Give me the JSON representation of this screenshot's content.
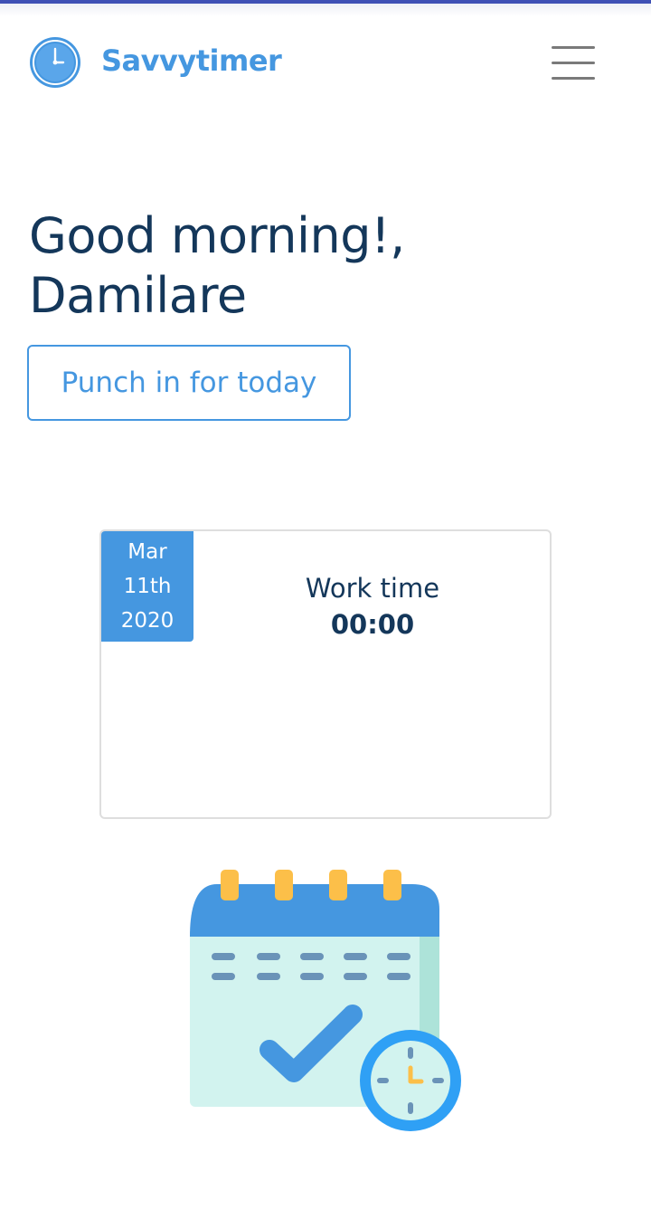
{
  "header": {
    "brand": "Savvytimer",
    "logo_icon": "clock-icon",
    "menu_icon": "hamburger-menu-icon"
  },
  "greeting": {
    "line1": "Good morning!,",
    "line2": "Damilare"
  },
  "punch_button": {
    "label": "Punch in for today"
  },
  "work_card": {
    "date": {
      "month": "Mar",
      "day": "11th",
      "year": "2020"
    },
    "label": "Work time",
    "value": "00:00"
  },
  "illustration": {
    "icon": "calendar-check-clock-icon"
  },
  "colors": {
    "accent": "#4597e0",
    "heading": "#14375a",
    "top_bar": "#3f51b5",
    "calendar_tab": "#fcbf49",
    "calendar_body": "#d2f3ef"
  }
}
